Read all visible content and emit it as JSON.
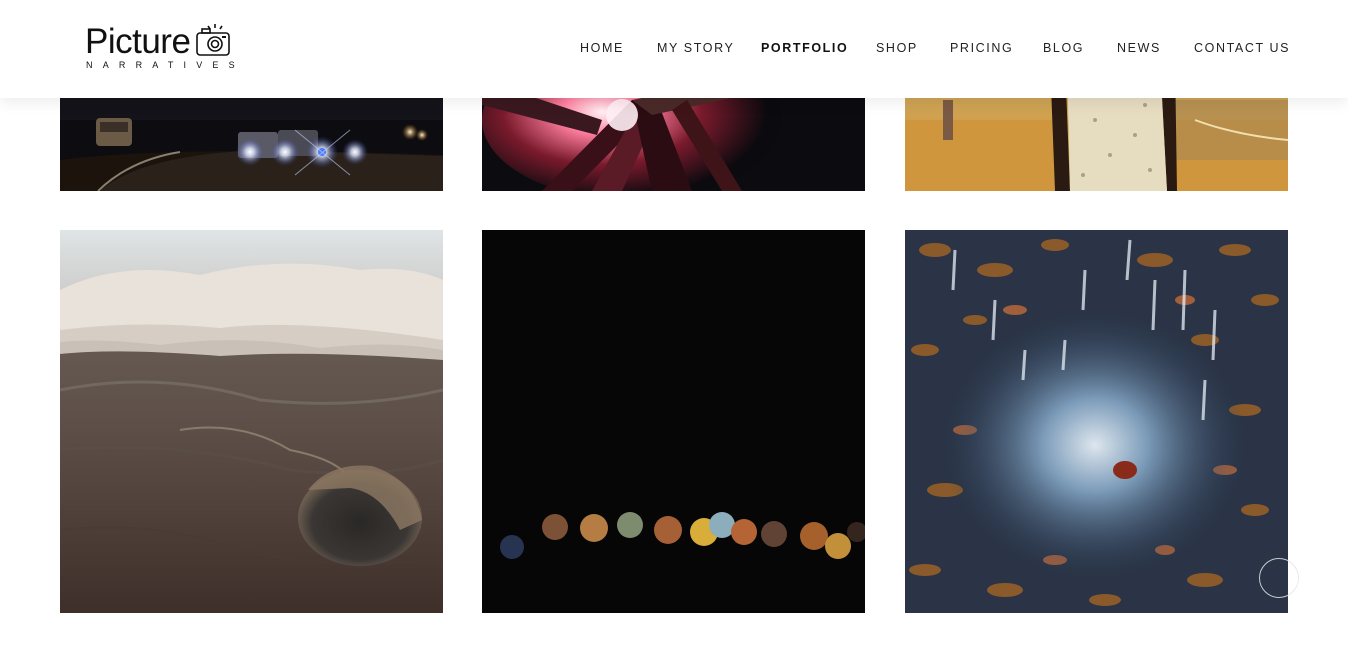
{
  "brand": {
    "name": "Picture",
    "tagline": "NARRATIVES",
    "logo_icon": "camera-icon"
  },
  "nav": {
    "items": [
      {
        "label": "HOME",
        "active": false
      },
      {
        "label": "MY STORY",
        "active": false
      },
      {
        "label": "PORTFOLIO",
        "active": true
      },
      {
        "label": "SHOP",
        "active": false
      },
      {
        "label": "PRICING",
        "active": false
      },
      {
        "label": "BLOG",
        "active": false
      },
      {
        "label": "NEWS",
        "active": false
      },
      {
        "label": "CONTACT US",
        "active": false
      }
    ]
  },
  "gallery": {
    "photos": [
      {
        "subject": "night road with car headlights"
      },
      {
        "subject": "glowing campfire logs"
      },
      {
        "subject": "person in patterned dress outdoors"
      },
      {
        "subject": "aerial view of clouds and volcanic crater"
      },
      {
        "subject": "bokeh lights at night"
      },
      {
        "subject": "rain splashing on leaves"
      }
    ]
  },
  "colors": {
    "header_bg": "#ffffff",
    "text": "#222222",
    "active_text": "#111111"
  }
}
